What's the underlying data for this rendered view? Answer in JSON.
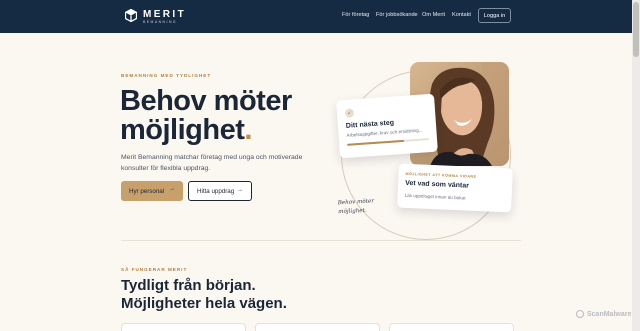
{
  "nav": {
    "brand": "MERIT",
    "brand_sub": "BEMANNING",
    "links": [
      "För företag",
      "För jobbsökande",
      "Om Merit",
      "Kontakt"
    ],
    "login_label": "Logga in"
  },
  "hero": {
    "eyebrow": "BEMANNING MED TYDLIGHET",
    "title_line1": "Behov möter",
    "title_line2": "möjlighet",
    "title_dot": ".",
    "description": "Merit Bemanning matchar företag med unga och motiverade konsulter för flexibla uppdrag.",
    "primary_button": "Hyr personal",
    "primary_arrow": "→",
    "secondary_button": "Hitta uppdrag",
    "secondary_arrow": "→"
  },
  "cards": {
    "step": {
      "check": "✓",
      "title": "Ditt nästa steg",
      "subtitle": "Arbetsuppgifter, krav och ersättning...",
      "progress": 0.7
    },
    "next": {
      "eyebrow": "MÖJLIGHET ATT KOMMA VIDARE",
      "title": "Vet vad som väntar",
      "subtitle": "Läs uppdraget innan du bokar."
    },
    "handwritten": "Behov möter möjlighet."
  },
  "section": {
    "eyebrow": "SÅ FUNGERAR MERIT",
    "title_line1": "Tydligt från början.",
    "title_line2": "Möjligheter hela vägen."
  },
  "watermark": "ScanMalware",
  "colors": {
    "nav_bg": "#142b43",
    "accent": "#c8a06c",
    "page_bg": "#fbf7f1",
    "text": "#1b2637"
  },
  "icons": [
    "merit-logo-icon",
    "arrow-right-icon",
    "check-icon"
  ]
}
